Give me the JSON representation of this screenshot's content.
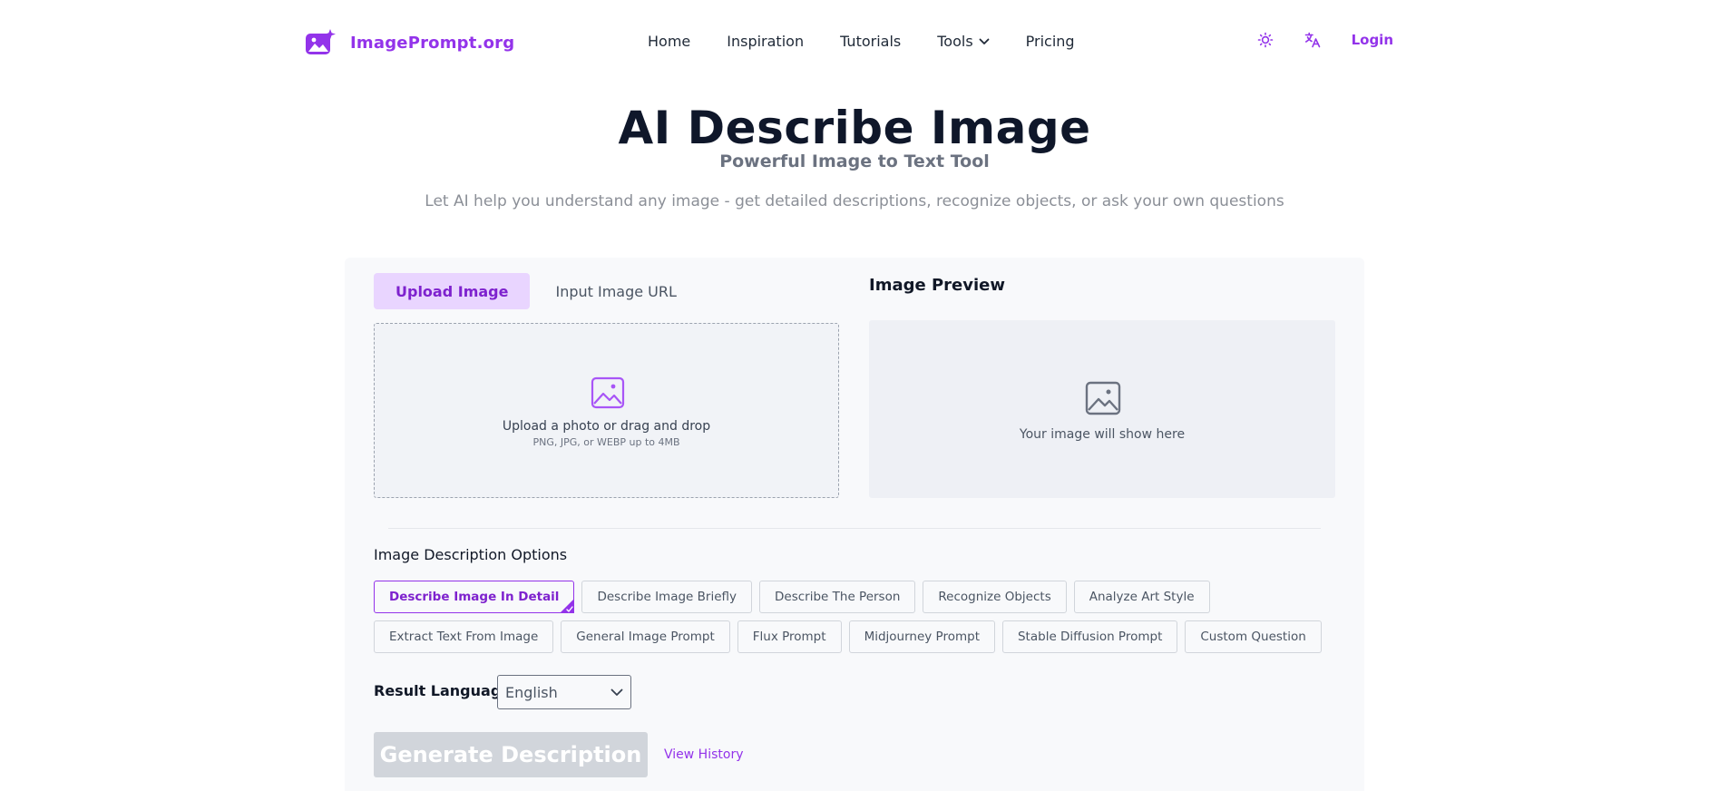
{
  "brand": {
    "name": "ImagePrompt.org",
    "color": "#9333ea"
  },
  "nav": {
    "items": [
      {
        "label": "Home"
      },
      {
        "label": "Inspiration"
      },
      {
        "label": "Tutorials"
      },
      {
        "label": "Tools",
        "has_dropdown": true
      },
      {
        "label": "Pricing"
      }
    ]
  },
  "header_actions": {
    "theme_icon": "sun-icon",
    "language_icon": "translate-icon",
    "login_label": "Login"
  },
  "hero": {
    "title": "AI Describe Image",
    "subtitle": "Powerful Image to Text Tool",
    "description": "Let AI help you understand any image - get detailed descriptions, recognize objects, or ask your own questions"
  },
  "input_tabs": {
    "active": "Upload Image",
    "items": [
      {
        "label": "Upload Image"
      },
      {
        "label": "Input Image URL"
      }
    ]
  },
  "upload": {
    "icon": "image-icon",
    "title": "Upload a photo or drag and drop",
    "hint": "PNG, JPG, or WEBP up to 4MB"
  },
  "preview": {
    "title": "Image Preview",
    "icon": "image-icon",
    "placeholder": "Your image will show here"
  },
  "options": {
    "title": "Image Description Options",
    "selected": "Describe Image In Detail",
    "row1": [
      {
        "label": "Describe Image In Detail"
      },
      {
        "label": "Describe Image Briefly"
      },
      {
        "label": "Describe The Person"
      },
      {
        "label": "Recognize Objects"
      },
      {
        "label": "Analyze Art Style"
      }
    ],
    "row2": [
      {
        "label": "Extract Text From Image"
      },
      {
        "label": "General Image Prompt"
      },
      {
        "label": "Flux Prompt"
      },
      {
        "label": "Midjourney Prompt"
      },
      {
        "label": "Stable Diffusion Prompt"
      },
      {
        "label": "Custom Question"
      }
    ]
  },
  "language": {
    "label": "Result Language",
    "value": "English"
  },
  "actions": {
    "generate_label": "Generate Description",
    "history_label": "View History"
  },
  "colors": {
    "accent": "#9333ea",
    "accent_light": "#e9d5ff",
    "disabled": "#d1d5db"
  }
}
